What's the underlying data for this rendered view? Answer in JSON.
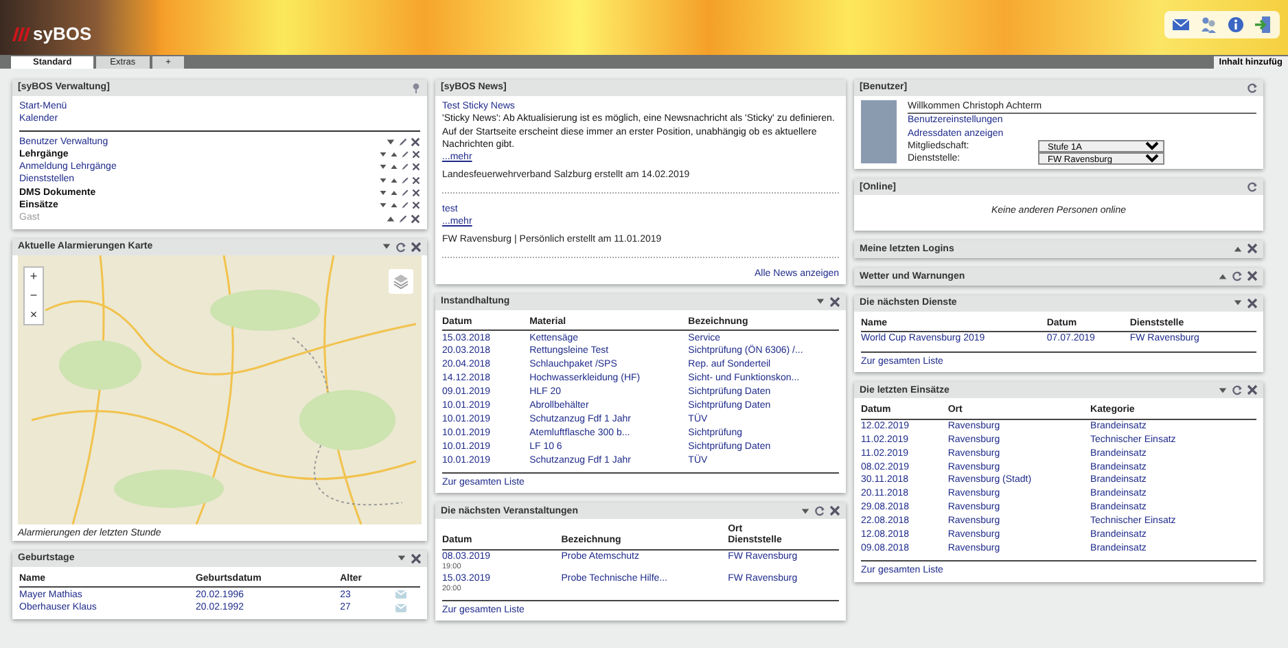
{
  "header": {
    "logo": "syBOS"
  },
  "tabs": [
    {
      "label": "Standard",
      "selected": true
    },
    {
      "label": "Extras",
      "selected": false
    },
    {
      "label": "+",
      "selected": false
    }
  ],
  "add_content": "Inhalt hinzufüg",
  "columns": [
    [
      {
        "title": "[syBOS Verwaltung]",
        "kind": "admin",
        "pinned": true,
        "links": [
          "Start-Menü",
          "Kalender"
        ],
        "items": [
          {
            "label": "Benutzer Verwaltung",
            "kind": "link",
            "disabled": false
          },
          {
            "label": "Lehrgänge",
            "kind": "group",
            "disabled": false
          },
          {
            "label": "Anmeldung Lehrgänge",
            "kind": "link",
            "disabled": false
          },
          {
            "label": "Dienststellen",
            "kind": "link",
            "disabled": false
          },
          {
            "label": "DMS Dokumente",
            "kind": "group",
            "disabled": false
          },
          {
            "label": "Einsätze",
            "kind": "group",
            "disabled": false
          },
          {
            "label": "Gast",
            "kind": "link",
            "disabled": true
          }
        ]
      },
      {
        "title": "Aktuelle Alarmierungen Karte",
        "kind": "map",
        "collapsed": false,
        "refreshable": true,
        "zoom": [
          "+",
          "−",
          "×"
        ],
        "caption": "Alarmierungen der letzten Stunde"
      },
      {
        "title": "Geburtstage",
        "kind": "birthdays",
        "collapsed": false,
        "refreshable": false,
        "columns": [
          "Name",
          "Geburtsdatum",
          "Alter"
        ],
        "rows": [
          [
            "Mayer Mathias",
            "20.02.1996",
            "23"
          ],
          [
            "Oberhauser Klaus",
            "20.02.1992",
            "27"
          ]
        ]
      }
    ],
    [
      {
        "title": "[syBOS News]",
        "kind": "news",
        "news": [
          {
            "title": "Test Sticky News",
            "text": "'Sticky News': Ab Aktualisierung ist es möglich, eine Newsnachricht als 'Sticky' zu definieren. Auf der Startseite erscheint diese immer an erster Position, unabhängig ob es aktuellere Nachrichten gibt.",
            "more": "...mehr",
            "meta": "Landesfeuerwehrverband Salzburg erstellt am 14.02.2019"
          },
          {
            "title": "test",
            "more": "...mehr",
            "meta": "FW Ravensburg | Persönlich erstellt am 11.01.2019"
          }
        ],
        "all": "Alle News anzeigen"
      },
      {
        "title": "Instandhaltung",
        "kind": "maintenance",
        "collapsed": false,
        "refreshable": false,
        "columns": [
          "Datum",
          "Material",
          "Bezeichnung"
        ],
        "rows": [
          [
            "15.03.2018",
            "Kettensäge",
            "Service"
          ],
          [
            "20.03.2018",
            "Rettungsleine Test",
            "Sichtprüfung (ÖN 6306) /..."
          ],
          [
            "20.04.2018",
            "Schlauchpaket /SPS",
            "Rep. auf Sonderteil"
          ],
          [
            "14.12.2018",
            "Hochwasserkleidung (HF)",
            "Sicht- und Funktionskon..."
          ],
          [
            "09.01.2019",
            "HLF 20",
            "Sichtprüfung Daten"
          ],
          [
            "10.01.2019",
            "Abrollbehälter",
            "Sichtprüfung Daten"
          ],
          [
            "10.01.2019",
            "Schutzanzug Fdf 1 Jahr",
            "TÜV"
          ],
          [
            "10.01.2019",
            "Atemluftflasche 300 b...",
            "Sichtprüfung"
          ],
          [
            "10.01.2019",
            "LF 10 6",
            "Sichtprüfung Daten"
          ],
          [
            "10.01.2019",
            "Schutzanzug Fdf 1 Jahr",
            "TÜV"
          ]
        ],
        "footer": "Zur gesamten Liste"
      },
      {
        "title": "Die nächsten Veranstaltungen",
        "kind": "events",
        "collapsed": false,
        "refreshable": true,
        "columns": [
          "Datum",
          "Bezeichnung",
          "Ort Dienststelle"
        ],
        "rows": [
          {
            "date": "08.03.2019",
            "time": "19:00",
            "title": "Probe Atemschutz",
            "place": "FW Ravensburg"
          },
          {
            "date": "15.03.2019",
            "time": "20:00",
            "title": "Probe Technische Hilfe...",
            "place": "FW Ravensburg"
          }
        ],
        "footer": "Zur gesamten Liste"
      }
    ],
    [
      {
        "title": "[Benutzer]",
        "kind": "user",
        "refreshable": true,
        "welcome": "Willkommen Christoph Achterm",
        "links": [
          "Benutzereinstellungen",
          "Adressdaten anzeigen"
        ],
        "settings": [
          {
            "label": "Mitgliedschaft:",
            "value": "Stufe 1A"
          },
          {
            "label": "Dienststelle:",
            "value": "FW Ravensburg"
          }
        ]
      },
      {
        "title": "[Online]",
        "kind": "message",
        "refreshable": true,
        "message": "Keine anderen Personen online"
      },
      {
        "title": "Meine letzten Logins",
        "kind": "message",
        "collapsed": true,
        "refreshable": false
      },
      {
        "title": "Wetter und Warnungen",
        "kind": "message",
        "collapsed": true,
        "refreshable": true
      },
      {
        "title": "Die nächsten Dienste",
        "kind": "duties",
        "collapsed": false,
        "refreshable": false,
        "columns": [
          "Name",
          "Datum",
          "Dienststelle"
        ],
        "rows": [
          [
            "World Cup Ravensburg 2019",
            "07.07.2019",
            "FW Ravensburg"
          ]
        ],
        "footer": "Zur gesamten Liste"
      },
      {
        "title": "Die letzten Einsätze",
        "kind": "missions",
        "collapsed": false,
        "refreshable": true,
        "columns": [
          "Datum",
          "Ort",
          "Kategorie"
        ],
        "rows": [
          [
            "12.02.2019",
            "Ravensburg",
            "Brandeinsatz"
          ],
          [
            "11.02.2019",
            "Ravensburg",
            "Technischer Einsatz"
          ],
          [
            "11.02.2019",
            "Ravensburg",
            "Brandeinsatz"
          ],
          [
            "08.02.2019",
            "Ravensburg",
            "Brandeinsatz"
          ],
          [
            "30.11.2018",
            "Ravensburg (Stadt)",
            "Brandeinsatz"
          ],
          [
            "20.11.2018",
            "Ravensburg",
            "Brandeinsatz"
          ],
          [
            "29.08.2018",
            "Ravensburg",
            "Brandeinsatz"
          ],
          [
            "22.08.2018",
            "Ravensburg",
            "Technischer Einsatz"
          ],
          [
            "12.08.2018",
            "Ravensburg",
            "Brandeinsatz"
          ],
          [
            "09.08.2018",
            "Ravensburg",
            "Brandeinsatz"
          ]
        ],
        "footer": "Zur gesamten Liste"
      }
    ]
  ]
}
